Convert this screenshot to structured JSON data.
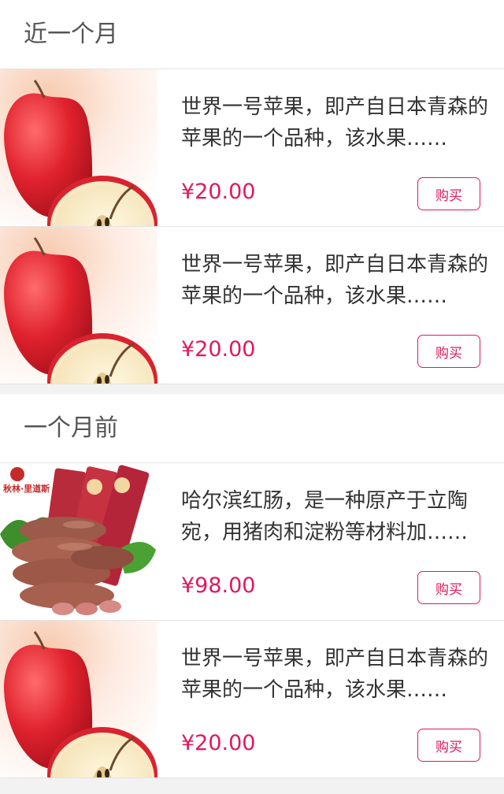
{
  "sections": [
    {
      "title": "近一个月",
      "items": [
        {
          "image": "apple-icon",
          "description": "世界一号苹果，即产自日本青森的苹果的一个品种，该水果……",
          "price": "¥20.00",
          "button": "购买"
        },
        {
          "image": "apple-icon",
          "description": "世界一号苹果，即产自日本青森的苹果的一个品种，该水果……",
          "price": "¥20.00",
          "button": "购买"
        }
      ]
    },
    {
      "title": "一个月前",
      "items": [
        {
          "image": "sausage-icon",
          "description": "哈尔滨红肠，是一种原产于立陶宛，用猪肉和淀粉等材料加……",
          "price": "¥98.00",
          "button": "购买",
          "brand_text": "秋林·里道斯"
        },
        {
          "image": "apple-icon",
          "description": "世界一号苹果，即产自日本青森的苹果的一个品种，该水果……",
          "price": "¥20.00",
          "button": "购买"
        }
      ]
    }
  ],
  "colors": {
    "accent": "#e0185e",
    "text": "#333333",
    "divider": "#e4e4e4",
    "background": "#f2f2f2"
  }
}
